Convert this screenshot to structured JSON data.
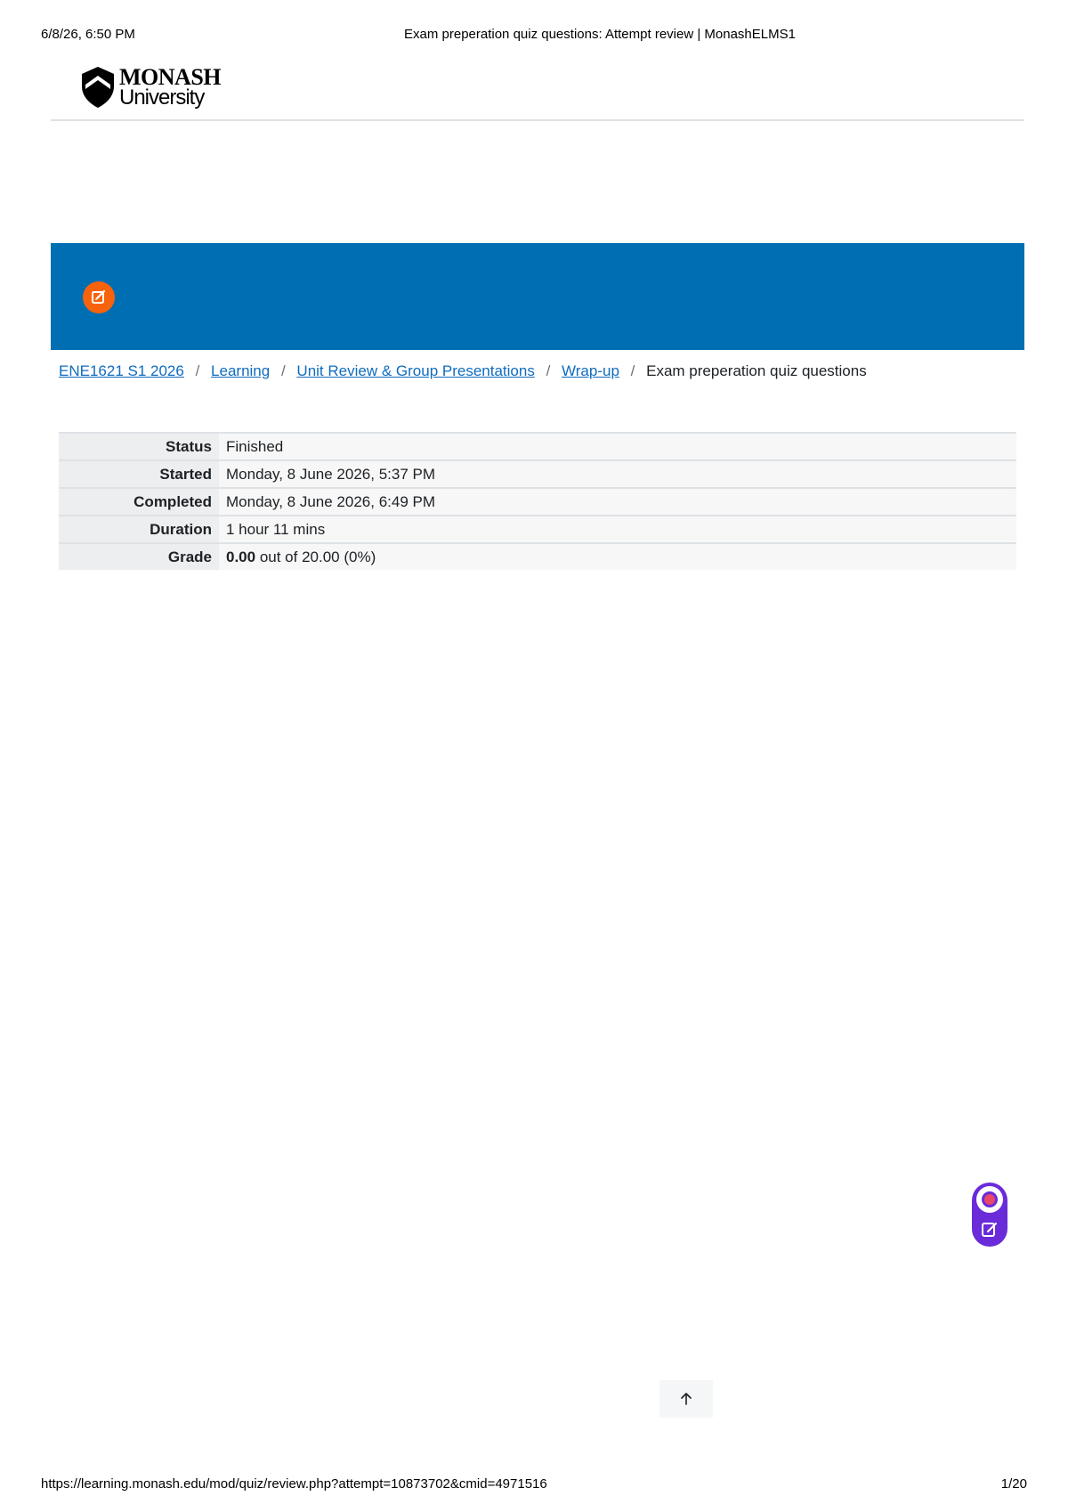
{
  "print_header": {
    "datetime": "6/8/26, 6:50 PM",
    "page_title": "Exam preperation quiz questions: Attempt review | MonashELMS1"
  },
  "brand": {
    "line1": "MONASH",
    "line2": "University"
  },
  "breadcrumb": {
    "items": [
      {
        "label": "ENE1621 S1 2026"
      },
      {
        "label": "Learning"
      },
      {
        "label": "Unit Review & Group Presentations"
      },
      {
        "label": "Wrap-up"
      }
    ],
    "current": "Exam preperation quiz questions",
    "separator": "/"
  },
  "summary": {
    "rows": [
      {
        "label": "Status",
        "value": "Finished"
      },
      {
        "label": "Started",
        "value": "Monday, 8 June 2026, 5:37 PM"
      },
      {
        "label": "Completed",
        "value": "Monday, 8 June 2026, 6:49 PM"
      },
      {
        "label": "Duration",
        "value": "1 hour 11 mins"
      },
      {
        "label": "Grade",
        "value_bold": "0.00",
        "value": " out of 20.00 (0%)"
      }
    ]
  },
  "icons": {
    "quiz": "quiz-edit-icon",
    "widget_top": "record-icon",
    "widget_bottom": "edit-note-icon",
    "back_to_top": "arrow-up-icon"
  },
  "colors": {
    "banner": "#006eb3",
    "quiz_icon": "#f7630c",
    "link": "#0f6cbf",
    "widget": "#6a2bd9"
  },
  "print_footer": {
    "url": "https://learning.monash.edu/mod/quiz/review.php?attempt=10873702&cmid=4971516",
    "page": "1/20"
  }
}
